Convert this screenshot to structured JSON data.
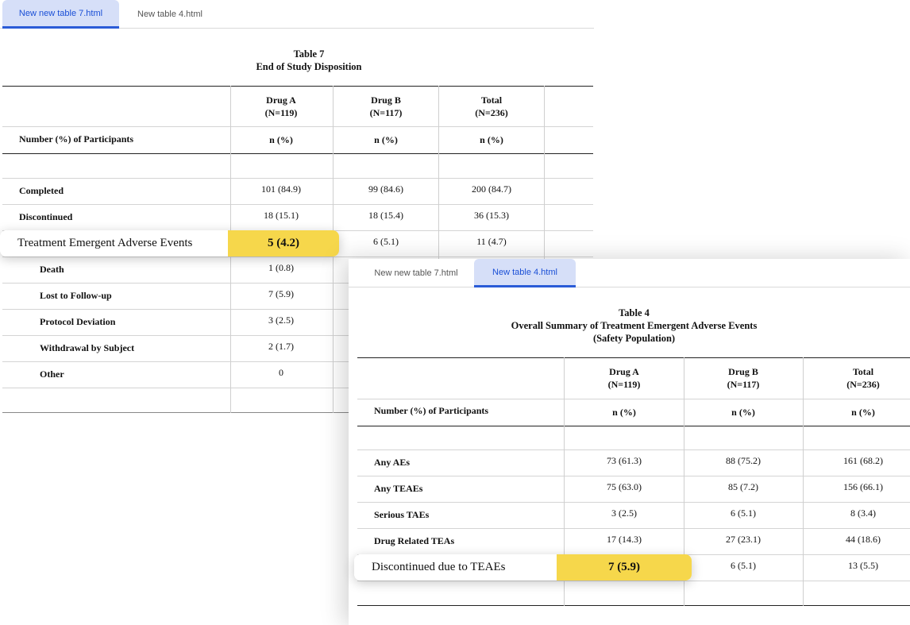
{
  "window1": {
    "tabs": [
      {
        "label": "New new table 7.html",
        "active": true
      },
      {
        "label": "New table 4.html",
        "active": false
      }
    ],
    "table_title": "Table 7",
    "table_subtitle": "End of Study Disposition",
    "columns": [
      {
        "name": "Drug A",
        "n": "(N=119)"
      },
      {
        "name": "Drug B",
        "n": "(N=117)"
      },
      {
        "name": "Total",
        "n": "(N=236)"
      }
    ],
    "row_header_label": "Number (%) of Participants",
    "stat_label": "n (%)",
    "rows": [
      {
        "label": "Completed",
        "values": [
          "101 (84.9)",
          "99 (84.6)",
          "200 (84.7)"
        ]
      },
      {
        "label": "Discontinued",
        "values": [
          "18 (15.1)",
          "18 (15.4)",
          "36 (15.3)"
        ]
      },
      {
        "label": "Treatment Emergent Adverse Events",
        "values": [
          "5 (4.2)",
          "6 (5.1)",
          "11 (4.7)"
        ]
      },
      {
        "label": "Death",
        "values": [
          "1 (0.8)",
          "",
          ""
        ]
      },
      {
        "label": "Lost to Follow-up",
        "values": [
          "7 (5.9)",
          "",
          ""
        ]
      },
      {
        "label": "Protocol Deviation",
        "values": [
          "3 (2.5)",
          "",
          ""
        ]
      },
      {
        "label": "Withdrawal by Subject",
        "values": [
          "2 (1.7)",
          "",
          ""
        ]
      },
      {
        "label": "Other",
        "values": [
          "0",
          "",
          ""
        ]
      }
    ],
    "highlight": {
      "label": "Treatment Emergent Adverse Events",
      "value": "5 (4.2)",
      "color": "#f6d74b"
    }
  },
  "window2": {
    "tabs": [
      {
        "label": "New new table 7.html",
        "active": false
      },
      {
        "label": "New table 4.html",
        "active": true
      }
    ],
    "table_title": "Table 4",
    "table_subtitle": "Overall Summary of Treatment Emergent Adverse Events",
    "table_population": "(Safety Population)",
    "columns": [
      {
        "name": "Drug A",
        "n": "(N=119)"
      },
      {
        "name": "Drug B",
        "n": "(N=117)"
      },
      {
        "name": "Total",
        "n": "(N=236)"
      }
    ],
    "row_header_label": "Number (%) of Participants",
    "stat_label": "n (%)",
    "rows": [
      {
        "label": "Any AEs",
        "values": [
          "73 (61.3)",
          "88 (75.2)",
          "161 (68.2)"
        ]
      },
      {
        "label": "Any TEAEs",
        "values": [
          "75 (63.0)",
          "85 (7.2)",
          "156 (66.1)"
        ]
      },
      {
        "label": "Serious TAEs",
        "values": [
          "3 (2.5)",
          "6 (5.1)",
          "8 (3.4)"
        ]
      },
      {
        "label": "Drug Related TEAs",
        "values": [
          "17 (14.3)",
          "27 (23.1)",
          "44 (18.6)"
        ]
      },
      {
        "label": "Discontinued due to TEAEs",
        "values": [
          "7 (5.9)",
          "6 (5.1)",
          "13 (5.5)"
        ]
      }
    ],
    "highlight": {
      "label": "Discontinued due to TEAEs",
      "value": "7 (5.9)",
      "color": "#f6d74b"
    }
  }
}
